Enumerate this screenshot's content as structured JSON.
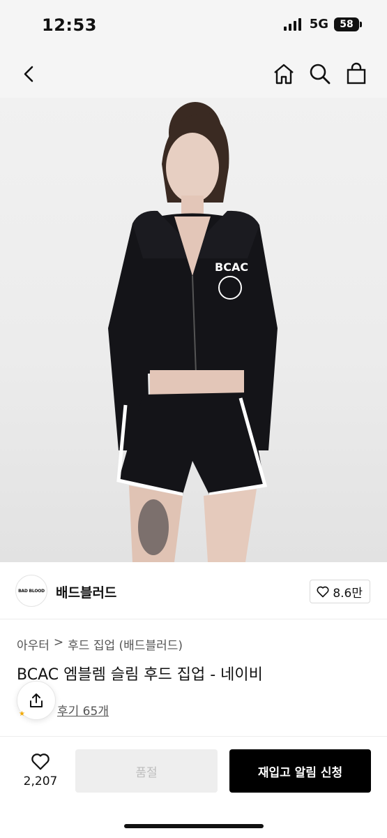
{
  "status_bar": {
    "time": "12:53",
    "network": "5G",
    "battery": "58"
  },
  "nav": {
    "back_icon": "chevron-left-icon",
    "home_icon": "home-icon",
    "search_icon": "search-icon",
    "cart_icon": "shopping-bag-icon"
  },
  "brand": {
    "logo_text": "BAD BLOOD",
    "name": "배드블러드",
    "like_count": "8.6만"
  },
  "breadcrumb": {
    "category": "아우터",
    "separator": ">",
    "subcategory": "후드 집업 (배드블러드)"
  },
  "product": {
    "title": "BCAC 엠블렘 슬림 후드 집업 - 네이비",
    "review_link": "후기 65개"
  },
  "bottom_bar": {
    "wish_count": "2,207",
    "soldout_label": "품절",
    "restock_label": "재입고 알림 신청"
  },
  "colors": {
    "accent": "#000000",
    "disabled_bg": "#eeeeee",
    "disabled_text": "#bdbdbd"
  }
}
